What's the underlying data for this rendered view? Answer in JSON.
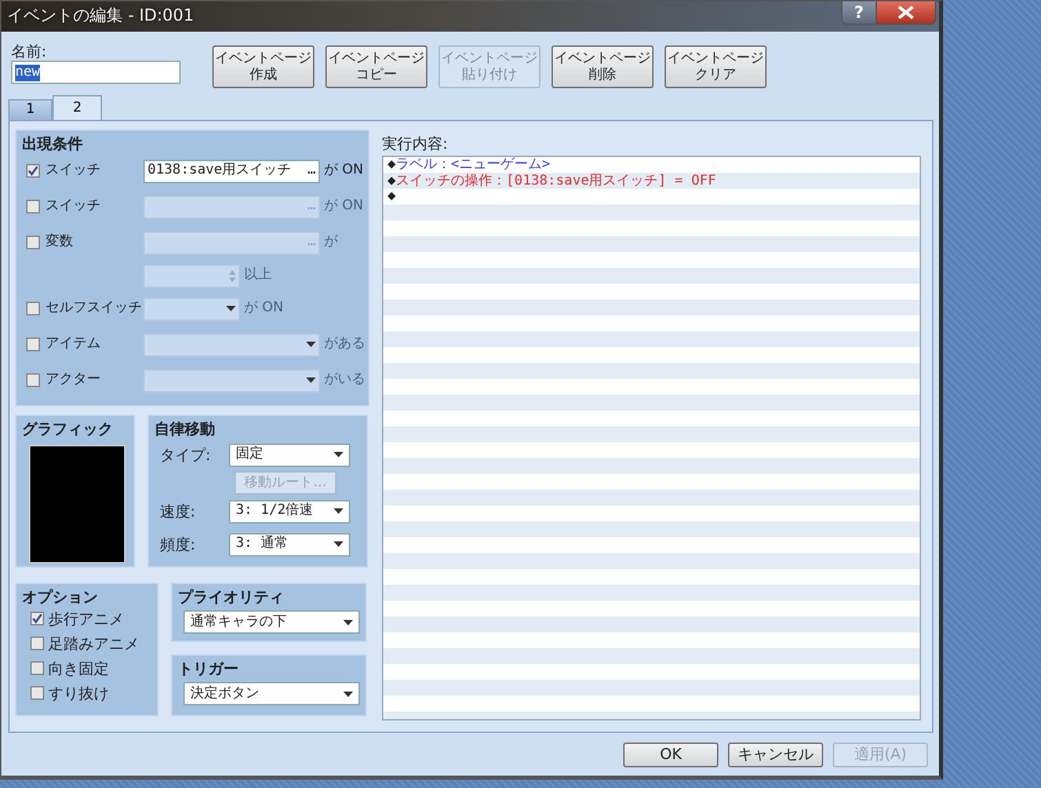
{
  "window": {
    "title": "イベントの編集 - ID:001",
    "help": "?"
  },
  "name": {
    "label": "名前:",
    "value": "new"
  },
  "page_buttons": [
    {
      "label": "イベントページ作成",
      "disabled": false
    },
    {
      "label": "イベントページコピー",
      "disabled": false
    },
    {
      "label": "イベントページ貼り付け",
      "disabled": true
    },
    {
      "label": "イベントページ削除",
      "disabled": false
    },
    {
      "label": "イベントページクリア",
      "disabled": false
    }
  ],
  "tabs": [
    {
      "label": "1",
      "selected": false
    },
    {
      "label": "2",
      "selected": true
    }
  ],
  "conditions": {
    "title": "出現条件",
    "items": [
      {
        "kind": "picker",
        "label": "スイッチ",
        "checked": true,
        "value": "0138:save用スイッチ",
        "button": "…",
        "suffix": "が ON"
      },
      {
        "kind": "picker",
        "label": "スイッチ",
        "checked": false,
        "button": "…",
        "suffix": "が ON"
      },
      {
        "kind": "picker",
        "label": "変数",
        "checked": false,
        "button": "…",
        "suffix": "が"
      },
      {
        "kind": "spin",
        "checked": false,
        "suffix": "以上"
      },
      {
        "kind": "short-combo",
        "label": "セルフスイッチ",
        "checked": false,
        "suffix": "が ON"
      },
      {
        "kind": "combo",
        "label": "アイテム",
        "checked": false,
        "suffix": "がある"
      },
      {
        "kind": "combo",
        "label": "アクター",
        "checked": false,
        "suffix": "がいる"
      }
    ]
  },
  "graphic": {
    "title": "グラフィック"
  },
  "movement": {
    "title": "自律移動",
    "type_label": "タイプ:",
    "type_value": "固定",
    "route_button": {
      "label": "移動ルート...",
      "disabled": true
    },
    "speed_label": "速度:",
    "speed_value": "3: 1/2倍速",
    "freq_label": "頻度:",
    "freq_value": "3: 通常"
  },
  "options": {
    "title": "オプション",
    "items": [
      {
        "label": "歩行アニメ",
        "checked": true
      },
      {
        "label": "足踏みアニメ",
        "checked": false
      },
      {
        "label": "向き固定",
        "checked": false
      },
      {
        "label": "すり抜け",
        "checked": false
      }
    ]
  },
  "priority": {
    "title": "プライオリティ",
    "value": "通常キャラの下"
  },
  "trigger": {
    "title": "トリガー",
    "value": "決定ボタン"
  },
  "contents": {
    "label": "実行内容:",
    "lines": [
      {
        "marker": "◆",
        "text": "ラベル：<ニューゲーム>",
        "color": "#3b3bf0"
      },
      {
        "marker": "◆",
        "text": "スイッチの操作：[0138:save用スイッチ] = OFF",
        "color": "#e82c2c"
      },
      {
        "marker": "◆"
      }
    ]
  },
  "footer_buttons": [
    {
      "label": "OK",
      "disabled": false
    },
    {
      "label": "キャンセル",
      "disabled": false
    },
    {
      "label": "適用(A)",
      "disabled": true
    }
  ]
}
